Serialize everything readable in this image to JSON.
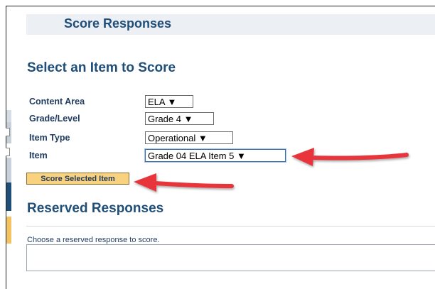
{
  "header": {
    "title": "Score Responses"
  },
  "select_section": {
    "title": "Select an Item to Score",
    "fields": [
      {
        "label": "Content Area",
        "value": "ELA"
      },
      {
        "label": "Grade/Level",
        "value": "Grade 4"
      },
      {
        "label": "Item Type",
        "value": "Operational"
      },
      {
        "label": "Item",
        "value": "Grade 04 ELA Item 5"
      }
    ],
    "button_label": "Score Selected Item"
  },
  "reserved_section": {
    "title": "Reserved Responses",
    "hint": "Choose a reserved response to score."
  },
  "colors": {
    "heading": "#1f4e79",
    "button_bg": "#f8d27f",
    "arrow": "#e8353b",
    "header_bg": "#eceff3"
  }
}
